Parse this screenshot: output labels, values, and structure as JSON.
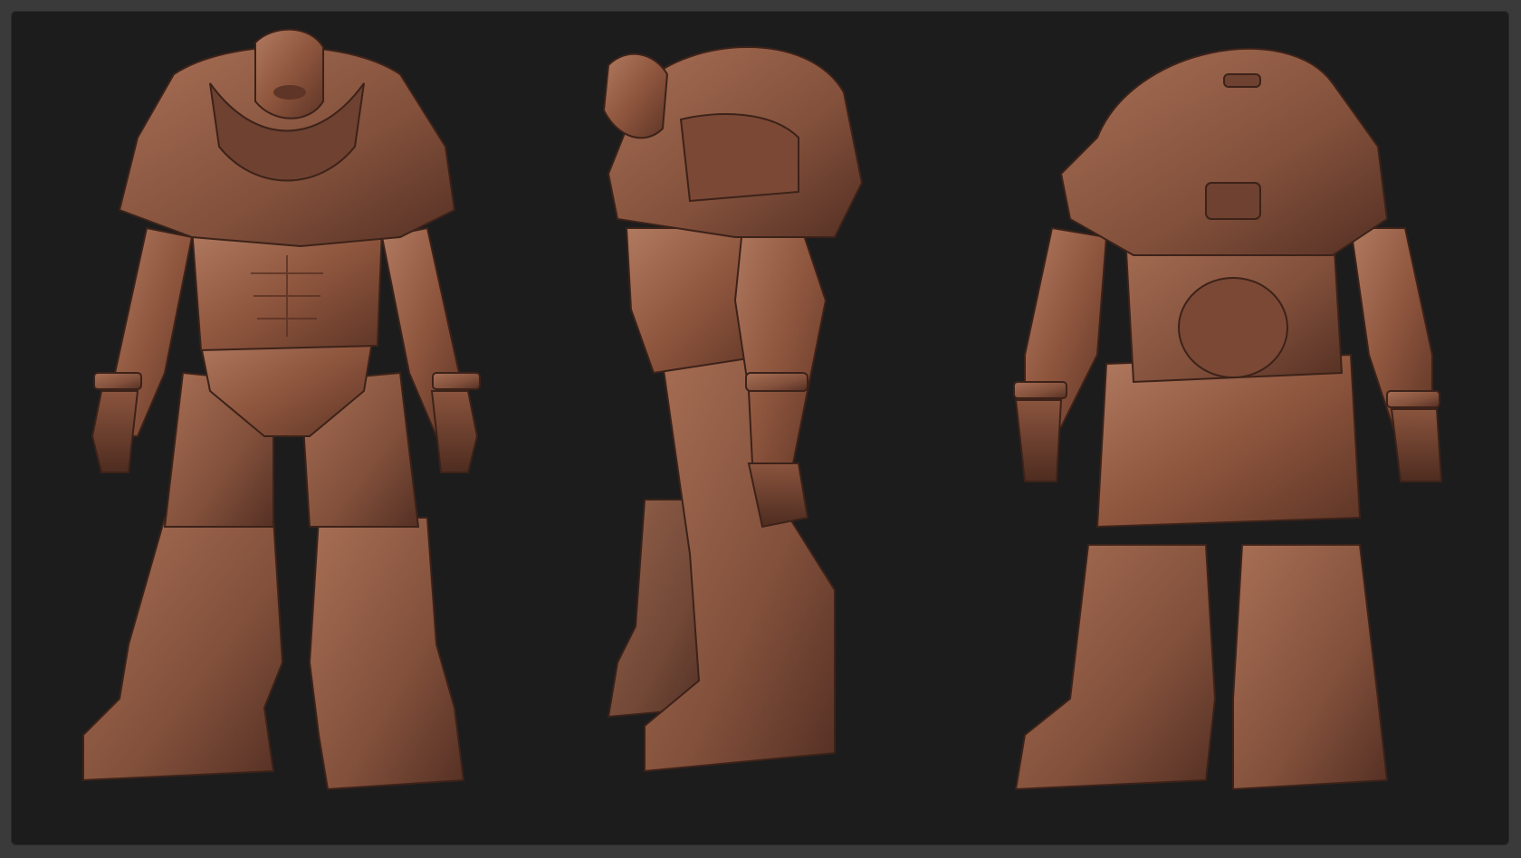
{
  "image": {
    "background_color": "#1c1c1d",
    "border_color": "#3a3a3a",
    "model_color": "#9a6148",
    "views": [
      {
        "id": "front",
        "icon": "sculpt-front-view-icon"
      },
      {
        "id": "side",
        "icon": "sculpt-side-view-icon"
      },
      {
        "id": "back",
        "icon": "sculpt-back-view-icon"
      }
    ]
  }
}
